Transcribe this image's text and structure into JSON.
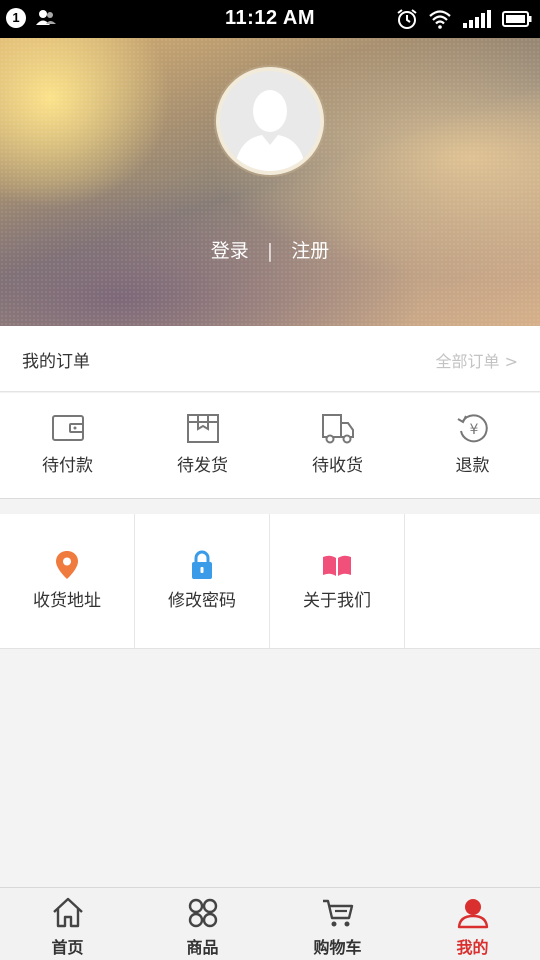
{
  "status_bar": {
    "notification_count": "1",
    "time": "11:12 AM"
  },
  "header": {
    "login_label": "登录",
    "separator": "|",
    "register_label": "注册"
  },
  "orders": {
    "title": "我的订单",
    "all_orders_label": "全部订单 >",
    "statuses": [
      {
        "label": "待付款",
        "icon": "wallet-icon"
      },
      {
        "label": "待发货",
        "icon": "package-icon"
      },
      {
        "label": "待收货",
        "icon": "delivery-truck-icon"
      },
      {
        "label": "退款",
        "icon": "refund-icon"
      }
    ]
  },
  "services": [
    {
      "label": "收货地址",
      "icon": "location-pin-icon",
      "color": "#f07b3f"
    },
    {
      "label": "修改密码",
      "icon": "lock-icon",
      "color": "#3a9be8"
    },
    {
      "label": "关于我们",
      "icon": "book-icon",
      "color": "#f0507a"
    }
  ],
  "tab_bar": {
    "tabs": [
      {
        "label": "首页",
        "icon": "home-icon"
      },
      {
        "label": "商品",
        "icon": "grid-circles-icon"
      },
      {
        "label": "购物车",
        "icon": "cart-icon"
      },
      {
        "label": "我的",
        "icon": "user-icon",
        "active": true
      }
    ],
    "active_color": "#d9302f"
  }
}
